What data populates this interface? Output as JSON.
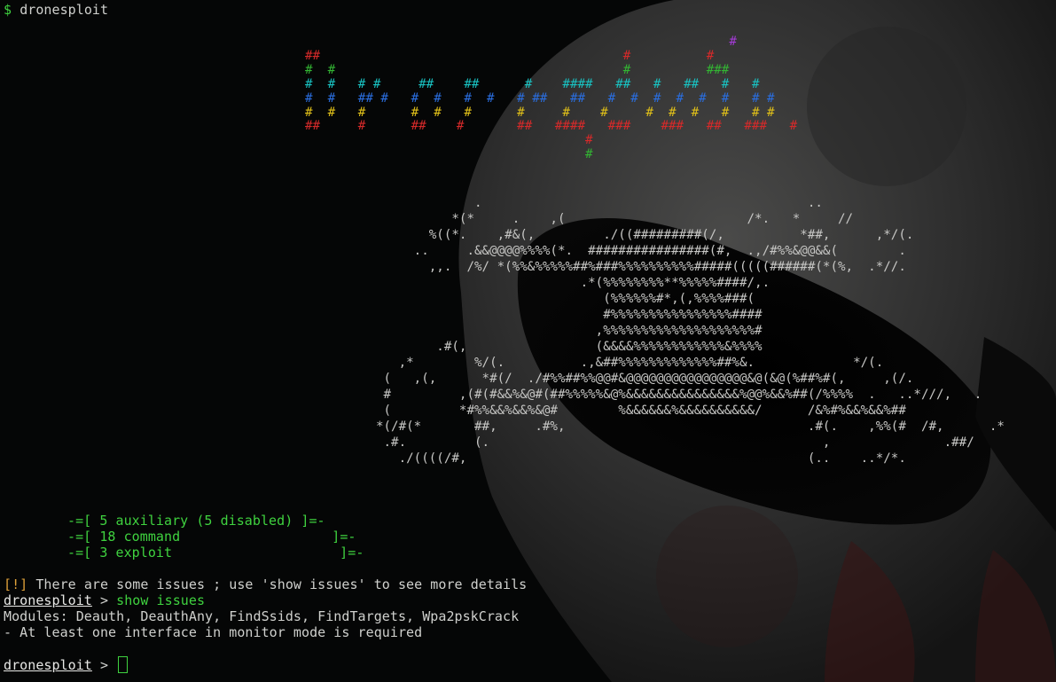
{
  "shell": {
    "dollar": "$",
    "command": "dronesploit"
  },
  "banner_rows": [
    "                                                        #",
    "##                                        #          #",
    "#  #                                      #          ###",
    "#  #   # #     ##    ##      #    ####   ##   #   ##   #   #",
    "#  #   ## #   #  #   #  #   # ##   ##   #  #  #  #  #  #   # #",
    "#  #   #      #  #   #      #     #    #     #  #  #   #   # #",
    "##     #      ##    #       ##   ####   ###    ###   ##   ###   #",
    "                                     #",
    "                                     #"
  ],
  "skull_art": [
    "                        .                                           ..",
    "                     *(*     .    ,(                        /*.   *     //",
    "                  %((*.    ,#&(,         ./((#########(/,          *##,      ,*/(.",
    "                ..     .&&@@@@%%%%(*.  ################(#,  .,/#%%&@@&&(        .",
    "                  ,,.  /%/ *(%%&%%%%%##%###%%%%%%%%%%#####(((((######(*(%,  .*//.",
    "                                      .*(%%%%%%%%**%%%%%####/,.",
    "                                         (%%%%%%#*,(,%%%%###(",
    "                                         #%%%%%%%%%%%%%%%%####",
    "                                        ,%%%%%%%%%%%%%%%%%%%%#",
    "                   .#(,                 (&&&&%%%%%%%%%%%%&%%%%",
    "              ,*        %/(.          .,&##%%%%%%%%%%%%%##%&.             */(.",
    "            (   ,(,      *#(/  ./#%%##%%@@#&@@@@@@@@@@@@@@@@&@(&@(%##%#(,     ,(/.",
    "            #         ,(#(#&&%&@#(##%%%%%&@%&&&&&&&&&&&&&&&%@@%&&%##(/%%%%  .   ..*///,   .",
    "            (         *#%%&&%&&%&@#        %&&&&&&%&&&&&&&&&&/      /&%#%&&%&&%##",
    "           *(/#(*       ##,     .#%,                                .#(.    ,%%(#  /#,      .*",
    "            .#.         (.                                            ,               .##/",
    "              ./((((/#,                                             (..    ..*/*."
  ],
  "modules": [
    {
      "prefix": "-=[ ",
      "count": "5",
      "name": "auxiliary (5 disabled)",
      "suffix": " ]=-"
    },
    {
      "prefix": "-=[ ",
      "count": "18",
      "name": "command",
      "suffix": " ]=-"
    },
    {
      "prefix": "-=[ ",
      "count": "3",
      "name": "exploit",
      "suffix": " ]=-"
    }
  ],
  "output": {
    "warn_tag": "[!]",
    "warn_text": " There are some issues ; use 'show issues' to see more details",
    "prompt_name": "dronesploit",
    "prompt_sep": " > ",
    "prompt_command": "show issues",
    "modules_line": "Modules: Deauth, DeauthAny, FindSsids, FindTargets, Wpa2pskCrack",
    "requirement_line": "- At least one interface in monitor mode is required",
    "final_prompt_name": "dronesploit",
    "final_prompt_sep": " > "
  },
  "colors": {
    "background": "#040505",
    "prompt_green": "#3fd23f",
    "warning_orange": "#e0a23a",
    "text": "#cfd0cd"
  }
}
